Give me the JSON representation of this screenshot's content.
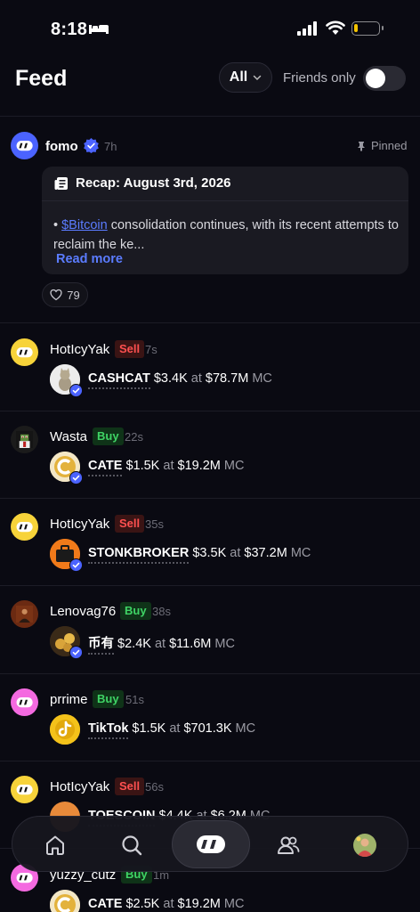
{
  "status_bar": {
    "time": "8:18"
  },
  "header": {
    "title": "Feed",
    "filter_selected": "All",
    "friends_only_label": "Friends only",
    "friends_only_enabled": false
  },
  "pinned_post": {
    "username": "fomo",
    "time": "7h",
    "pinned_label": "Pinned",
    "recap_title": "Recap: August 3rd, 2026",
    "ticker_link": "$Bitcoin",
    "excerpt": "consolidation continues, with its recent attempts to reclaim the ke...",
    "read_more": "Read more",
    "likes": "79"
  },
  "trades": [
    {
      "user": "HotIcyYak",
      "side": "Sell",
      "ago": "7s",
      "token": "CASHCAT",
      "amount": "$3.4K",
      "at": "at",
      "mc": "$78.7M",
      "mc_label": "MC"
    },
    {
      "user": "Wasta",
      "side": "Buy",
      "ago": "22s",
      "token": "CATE",
      "amount": "$1.5K",
      "at": "at",
      "mc": "$19.2M",
      "mc_label": "MC"
    },
    {
      "user": "HotIcyYak",
      "side": "Sell",
      "ago": "35s",
      "token": "STONKBROKER",
      "amount": "$3.5K",
      "at": "at",
      "mc": "$37.2M",
      "mc_label": "MC"
    },
    {
      "user": "Lenovag76",
      "side": "Buy",
      "ago": "38s",
      "token": "币有",
      "amount": "$2.4K",
      "at": "at",
      "mc": "$11.6M",
      "mc_label": "MC"
    },
    {
      "user": "prrime",
      "side": "Buy",
      "ago": "51s",
      "token": "TikTok",
      "amount": "$1.5K",
      "at": "at",
      "mc": "$701.3K",
      "mc_label": "MC"
    },
    {
      "user": "HotIcyYak",
      "side": "Sell",
      "ago": "56s",
      "token": "TOESCOIN",
      "amount": "$4.4K",
      "at": "at",
      "mc": "$6.2M",
      "mc_label": "MC"
    },
    {
      "user": "yuzzy_cutz",
      "side": "Buy",
      "ago": "1m",
      "token": "CATE",
      "amount": "$2.5K",
      "at": "at",
      "mc": "$19.2M",
      "mc_label": "MC"
    }
  ],
  "nav": {
    "items": [
      "home-icon",
      "search-icon",
      "fomo-logo-icon",
      "friends-icon",
      "profile-avatar"
    ],
    "active": "fomo-logo-icon"
  },
  "colors": {
    "background": "#0a0a12",
    "accent": "#5b7cff",
    "sell": "#ff5050",
    "buy": "#3fd465"
  }
}
